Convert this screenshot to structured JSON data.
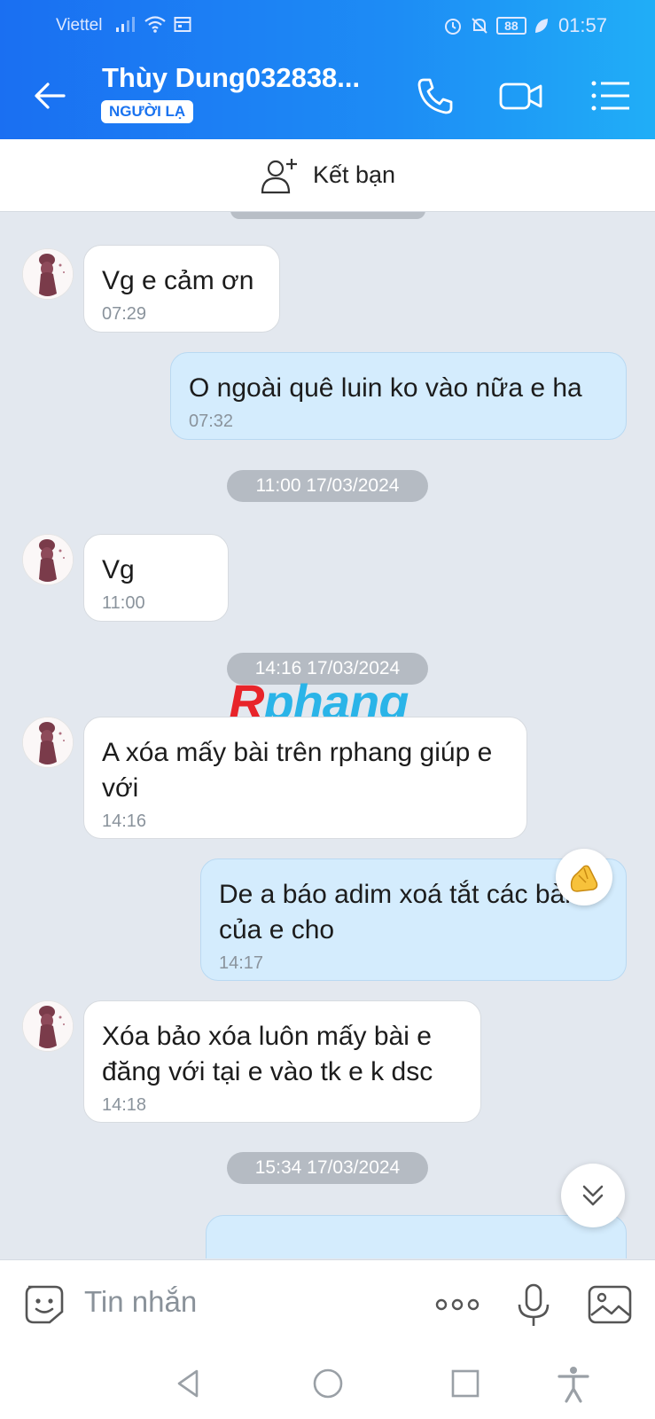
{
  "status": {
    "carrier": "Viettel",
    "battery": "88",
    "time": "01:57"
  },
  "header": {
    "contact_name": "Thùy Dung032838...",
    "stranger_badge": "NGƯỜI LẠ"
  },
  "add_friend": {
    "label": "Kết bạn"
  },
  "messages": [
    {
      "side": "in",
      "text": "Vg e cảm ơn",
      "time": "07:29"
    },
    {
      "side": "out",
      "text": "O ngoài quê luin ko vào nữa e ha",
      "time": "07:32"
    },
    {
      "side": "divider",
      "text": "11:00 17/03/2024"
    },
    {
      "side": "in",
      "text": "Vg",
      "time": "11:00"
    },
    {
      "side": "divider",
      "text": "14:16 17/03/2024"
    },
    {
      "side": "in",
      "text": "A xóa mấy bài trên rphang giúp e với",
      "time": "14:16"
    },
    {
      "side": "out",
      "text": "De a báo adim xoá tắt các bài của e cho",
      "time": "14:17",
      "reaction": "pinched-hand-emoji"
    },
    {
      "side": "in",
      "text": "Xóa bảo xóa luôn mấy bài e đăng với tại e vào tk e k dsc",
      "time": "14:18"
    },
    {
      "side": "divider",
      "text": "15:34 17/03/2024"
    }
  ],
  "watermark": {
    "first": "R",
    "rest": "phang"
  },
  "composer": {
    "placeholder": "Tin nhắn"
  },
  "colors": {
    "header_start": "#1a6ff2",
    "header_end": "#20aef7",
    "chat_bg": "#e3e8ef",
    "outgoing_bubble": "#d4ecfd",
    "incoming_bubble": "#ffffff"
  }
}
